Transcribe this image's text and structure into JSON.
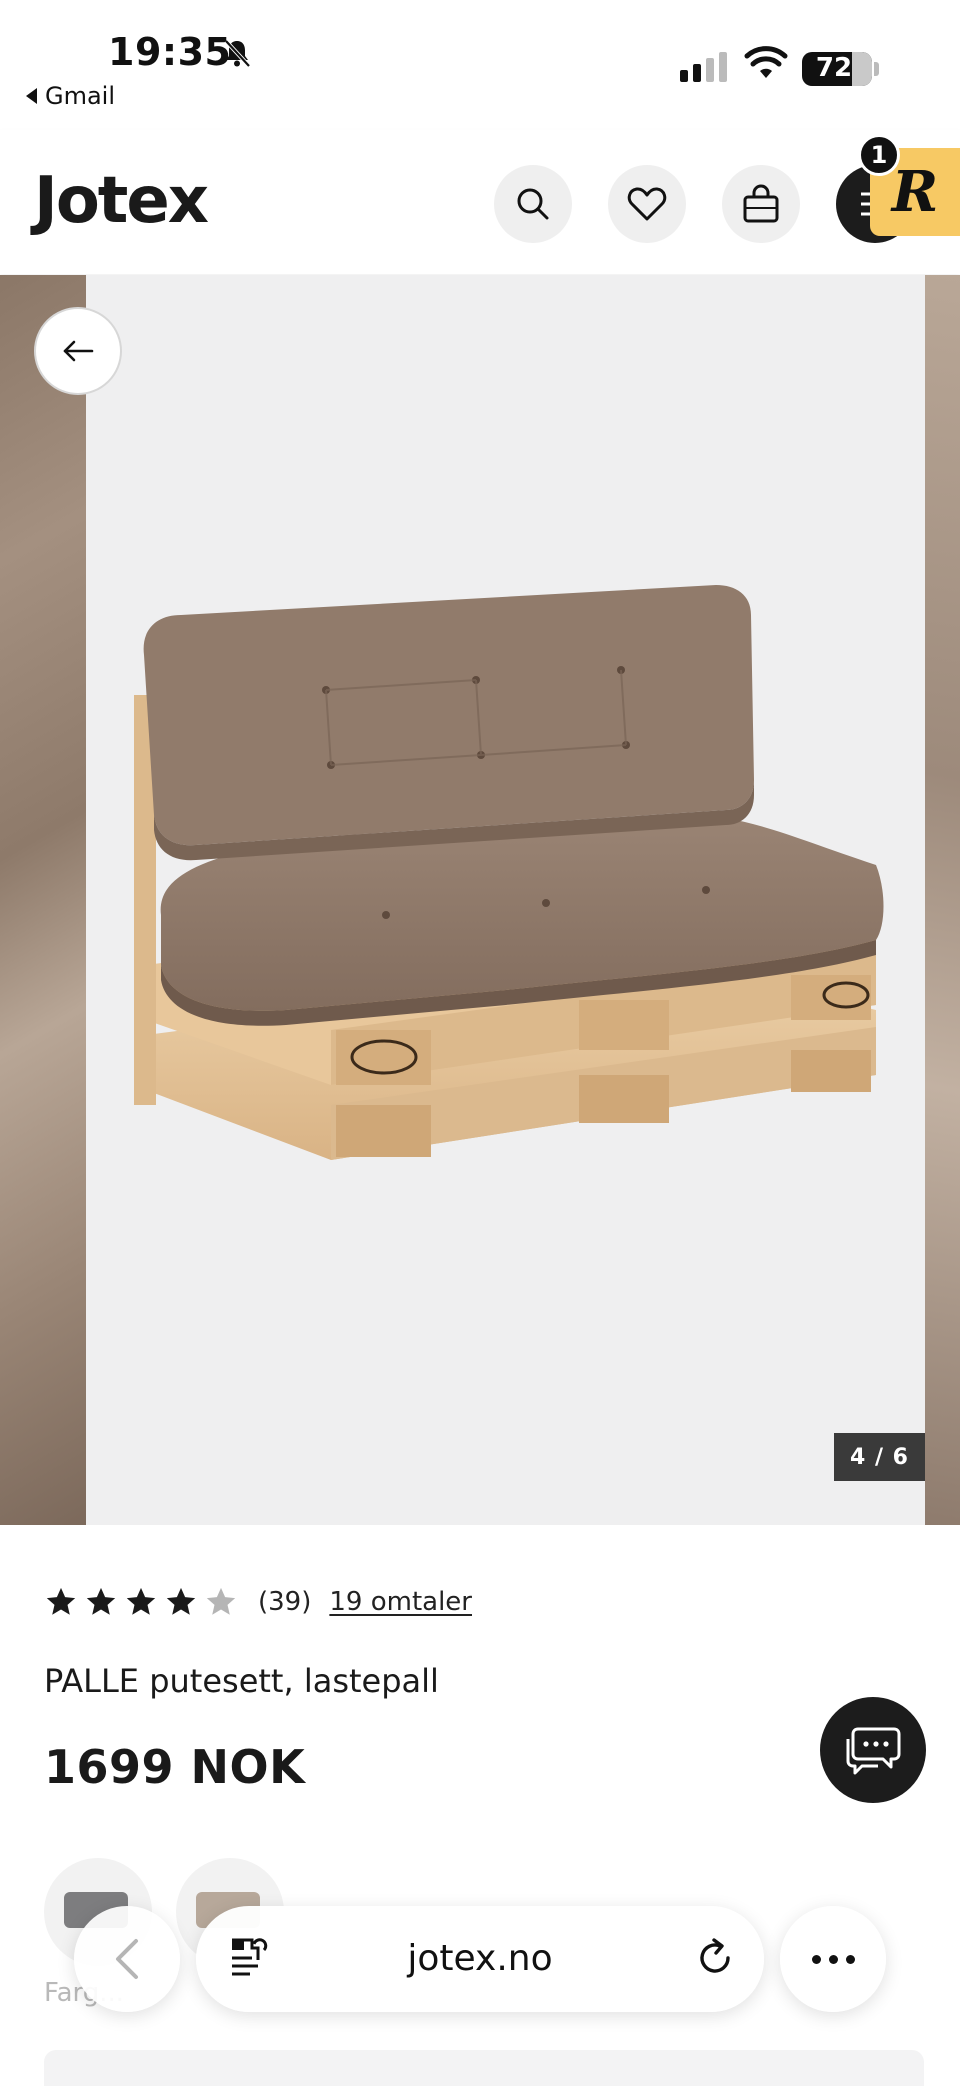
{
  "status_bar": {
    "time": "19:35",
    "back_app": "Gmail",
    "battery": "72",
    "battery_level_percent": 72,
    "icons": [
      "bell-slash-icon",
      "signal-icon",
      "wifi-icon",
      "battery-icon"
    ]
  },
  "header": {
    "logo": "Jotex",
    "icons": [
      "search-icon",
      "heart-icon",
      "bag-icon",
      "menu-icon"
    ],
    "badge_count": "1",
    "r_tab_letter": "R"
  },
  "gallery": {
    "counter": "4 / 6"
  },
  "product": {
    "rating": 4,
    "rating_max": 5,
    "rating_count": "(39)",
    "reviews_link": "19 omtaler",
    "name": "PALLE putesett, lastepall",
    "price": "1699 NOK",
    "color_label": "Farg...",
    "swatches": [
      {
        "name": "grey",
        "color": "#7d7d7f"
      },
      {
        "name": "beige",
        "color": "#b7a89a"
      }
    ]
  },
  "browser": {
    "url": "jotex.no"
  },
  "colors": {
    "cushion": "#8b7566",
    "pallet": "#e7c59a",
    "chat_button": "#1c1c1c",
    "r_tab": "#f7c964"
  }
}
